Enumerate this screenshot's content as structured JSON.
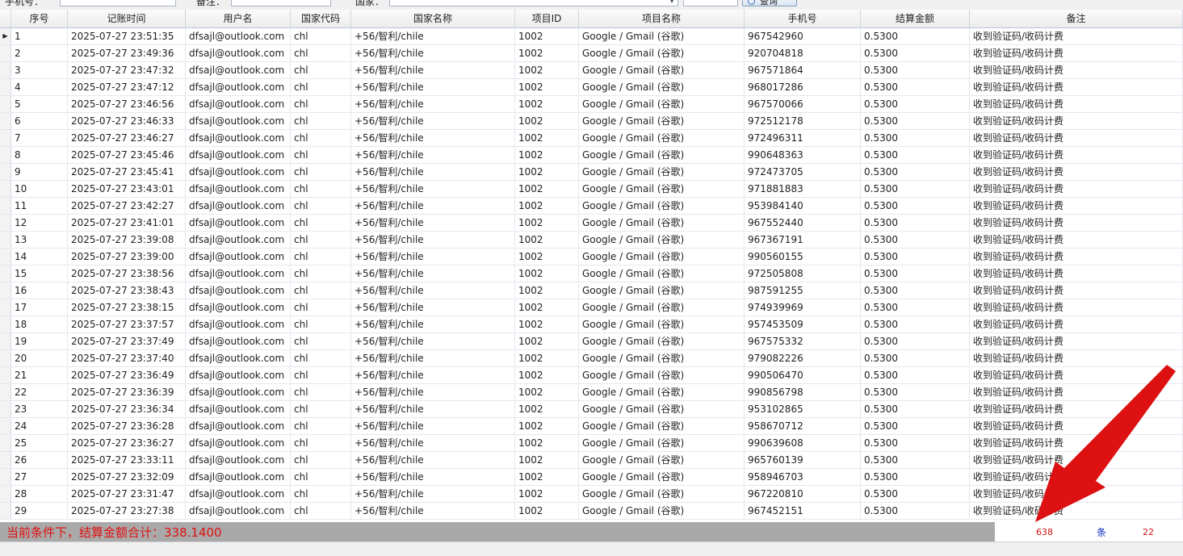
{
  "filters": {
    "phone_label": "手机号：",
    "remark_label": "备注：",
    "country_label": "国家：",
    "query_button": "查询"
  },
  "columns": [
    "序号",
    "记账时间",
    "用户名",
    "国家代码",
    "国家名称",
    "项目ID",
    "项目名称",
    "手机号",
    "结算金额",
    "备注"
  ],
  "rows": [
    [
      "1",
      "2025-07-27 23:51:35",
      "dfsajl@outlook.com",
      "chl",
      "+56/智利/chile",
      "1002",
      "Google / Gmail (谷歌)",
      "967542960",
      "0.5300",
      "收到验证码/收码计费"
    ],
    [
      "2",
      "2025-07-27 23:49:36",
      "dfsajl@outlook.com",
      "chl",
      "+56/智利/chile",
      "1002",
      "Google / Gmail (谷歌)",
      "920704818",
      "0.5300",
      "收到验证码/收码计费"
    ],
    [
      "3",
      "2025-07-27 23:47:32",
      "dfsajl@outlook.com",
      "chl",
      "+56/智利/chile",
      "1002",
      "Google / Gmail (谷歌)",
      "967571864",
      "0.5300",
      "收到验证码/收码计费"
    ],
    [
      "4",
      "2025-07-27 23:47:12",
      "dfsajl@outlook.com",
      "chl",
      "+56/智利/chile",
      "1002",
      "Google / Gmail (谷歌)",
      "968017286",
      "0.5300",
      "收到验证码/收码计费"
    ],
    [
      "5",
      "2025-07-27 23:46:56",
      "dfsajl@outlook.com",
      "chl",
      "+56/智利/chile",
      "1002",
      "Google / Gmail (谷歌)",
      "967570066",
      "0.5300",
      "收到验证码/收码计费"
    ],
    [
      "6",
      "2025-07-27 23:46:33",
      "dfsajl@outlook.com",
      "chl",
      "+56/智利/chile",
      "1002",
      "Google / Gmail (谷歌)",
      "972512178",
      "0.5300",
      "收到验证码/收码计费"
    ],
    [
      "7",
      "2025-07-27 23:46:27",
      "dfsajl@outlook.com",
      "chl",
      "+56/智利/chile",
      "1002",
      "Google / Gmail (谷歌)",
      "972496311",
      "0.5300",
      "收到验证码/收码计费"
    ],
    [
      "8",
      "2025-07-27 23:45:46",
      "dfsajl@outlook.com",
      "chl",
      "+56/智利/chile",
      "1002",
      "Google / Gmail (谷歌)",
      "990648363",
      "0.5300",
      "收到验证码/收码计费"
    ],
    [
      "9",
      "2025-07-27 23:45:41",
      "dfsajl@outlook.com",
      "chl",
      "+56/智利/chile",
      "1002",
      "Google / Gmail (谷歌)",
      "972473705",
      "0.5300",
      "收到验证码/收码计费"
    ],
    [
      "10",
      "2025-07-27 23:43:01",
      "dfsajl@outlook.com",
      "chl",
      "+56/智利/chile",
      "1002",
      "Google / Gmail (谷歌)",
      "971881883",
      "0.5300",
      "收到验证码/收码计费"
    ],
    [
      "11",
      "2025-07-27 23:42:27",
      "dfsajl@outlook.com",
      "chl",
      "+56/智利/chile",
      "1002",
      "Google / Gmail (谷歌)",
      "953984140",
      "0.5300",
      "收到验证码/收码计费"
    ],
    [
      "12",
      "2025-07-27 23:41:01",
      "dfsajl@outlook.com",
      "chl",
      "+56/智利/chile",
      "1002",
      "Google / Gmail (谷歌)",
      "967552440",
      "0.5300",
      "收到验证码/收码计费"
    ],
    [
      "13",
      "2025-07-27 23:39:08",
      "dfsajl@outlook.com",
      "chl",
      "+56/智利/chile",
      "1002",
      "Google / Gmail (谷歌)",
      "967367191",
      "0.5300",
      "收到验证码/收码计费"
    ],
    [
      "14",
      "2025-07-27 23:39:00",
      "dfsajl@outlook.com",
      "chl",
      "+56/智利/chile",
      "1002",
      "Google / Gmail (谷歌)",
      "990560155",
      "0.5300",
      "收到验证码/收码计费"
    ],
    [
      "15",
      "2025-07-27 23:38:56",
      "dfsajl@outlook.com",
      "chl",
      "+56/智利/chile",
      "1002",
      "Google / Gmail (谷歌)",
      "972505808",
      "0.5300",
      "收到验证码/收码计费"
    ],
    [
      "16",
      "2025-07-27 23:38:43",
      "dfsajl@outlook.com",
      "chl",
      "+56/智利/chile",
      "1002",
      "Google / Gmail (谷歌)",
      "987591255",
      "0.5300",
      "收到验证码/收码计费"
    ],
    [
      "17",
      "2025-07-27 23:38:15",
      "dfsajl@outlook.com",
      "chl",
      "+56/智利/chile",
      "1002",
      "Google / Gmail (谷歌)",
      "974939969",
      "0.5300",
      "收到验证码/收码计费"
    ],
    [
      "18",
      "2025-07-27 23:37:57",
      "dfsajl@outlook.com",
      "chl",
      "+56/智利/chile",
      "1002",
      "Google / Gmail (谷歌)",
      "957453509",
      "0.5300",
      "收到验证码/收码计费"
    ],
    [
      "19",
      "2025-07-27 23:37:49",
      "dfsajl@outlook.com",
      "chl",
      "+56/智利/chile",
      "1002",
      "Google / Gmail (谷歌)",
      "967575332",
      "0.5300",
      "收到验证码/收码计费"
    ],
    [
      "20",
      "2025-07-27 23:37:40",
      "dfsajl@outlook.com",
      "chl",
      "+56/智利/chile",
      "1002",
      "Google / Gmail (谷歌)",
      "979082226",
      "0.5300",
      "收到验证码/收码计费"
    ],
    [
      "21",
      "2025-07-27 23:36:49",
      "dfsajl@outlook.com",
      "chl",
      "+56/智利/chile",
      "1002",
      "Google / Gmail (谷歌)",
      "990506470",
      "0.5300",
      "收到验证码/收码计费"
    ],
    [
      "22",
      "2025-07-27 23:36:39",
      "dfsajl@outlook.com",
      "chl",
      "+56/智利/chile",
      "1002",
      "Google / Gmail (谷歌)",
      "990856798",
      "0.5300",
      "收到验证码/收码计费"
    ],
    [
      "23",
      "2025-07-27 23:36:34",
      "dfsajl@outlook.com",
      "chl",
      "+56/智利/chile",
      "1002",
      "Google / Gmail (谷歌)",
      "953102865",
      "0.5300",
      "收到验证码/收码计费"
    ],
    [
      "24",
      "2025-07-27 23:36:28",
      "dfsajl@outlook.com",
      "chl",
      "+56/智利/chile",
      "1002",
      "Google / Gmail (谷歌)",
      "958670712",
      "0.5300",
      "收到验证码/收码计费"
    ],
    [
      "25",
      "2025-07-27 23:36:27",
      "dfsajl@outlook.com",
      "chl",
      "+56/智利/chile",
      "1002",
      "Google / Gmail (谷歌)",
      "990639608",
      "0.5300",
      "收到验证码/收码计费"
    ],
    [
      "26",
      "2025-07-27 23:33:11",
      "dfsajl@outlook.com",
      "chl",
      "+56/智利/chile",
      "1002",
      "Google / Gmail (谷歌)",
      "965760139",
      "0.5300",
      "收到验证码/收码计费"
    ],
    [
      "27",
      "2025-07-27 23:32:09",
      "dfsajl@outlook.com",
      "chl",
      "+56/智利/chile",
      "1002",
      "Google / Gmail (谷歌)",
      "958946703",
      "0.5300",
      "收到验证码/收码计费"
    ],
    [
      "28",
      "2025-07-27 23:31:47",
      "dfsajl@outlook.com",
      "chl",
      "+56/智利/chile",
      "1002",
      "Google / Gmail (谷歌)",
      "967220810",
      "0.5300",
      "收到验证码/收码计费"
    ],
    [
      "29",
      "2025-07-27 23:27:38",
      "dfsajl@outlook.com",
      "chl",
      "+56/智利/chile",
      "1002",
      "Google / Gmail (谷歌)",
      "967452151",
      "0.5300",
      "收到验证码/收码计费"
    ]
  ],
  "summary": {
    "total_text": "当前条件下，结算金额合计：338.1400",
    "record_count": "638",
    "record_unit": "条",
    "page_count": "22"
  },
  "colors": {
    "summary_text": "#e01010",
    "arrow": "#dd1111",
    "unit_text": "#1030c0"
  },
  "icons": {
    "row_indicator": "current-row-triangle-icon",
    "query": "magnifier-icon",
    "annotation": "red-arrow-annotation"
  }
}
